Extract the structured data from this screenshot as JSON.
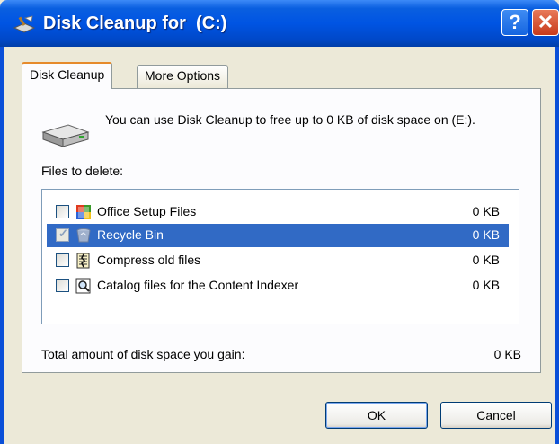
{
  "window": {
    "title": "Disk Cleanup for  (C:)",
    "help_glyph": "?",
    "close_glyph": "✕"
  },
  "tabs": [
    {
      "label": "Disk Cleanup",
      "active": true
    },
    {
      "label": "More Options",
      "active": false
    }
  ],
  "info": {
    "text": "You can use Disk Cleanup to free up to 0 KB of disk space on  (E:)."
  },
  "files": {
    "label": "Files to delete:",
    "items": [
      {
        "name": "Office Setup Files",
        "size": "0 KB",
        "checked": false,
        "selected": false,
        "icon": "office-setup-icon"
      },
      {
        "name": "Recycle Bin",
        "size": "0 KB",
        "checked": true,
        "selected": true,
        "icon": "recycle-bin-icon"
      },
      {
        "name": "Compress old files",
        "size": "0 KB",
        "checked": false,
        "selected": false,
        "icon": "compress-icon"
      },
      {
        "name": "Catalog files for the Content Indexer",
        "size": "0 KB",
        "checked": false,
        "selected": false,
        "icon": "catalog-icon"
      }
    ]
  },
  "total": {
    "label": "Total amount of disk space you gain:",
    "value": "0 KB"
  },
  "buttons": {
    "ok": "OK",
    "cancel": "Cancel"
  },
  "colors": {
    "titlebar": "#0054e3",
    "selection": "#316ac5",
    "background": "#ece9d8"
  }
}
